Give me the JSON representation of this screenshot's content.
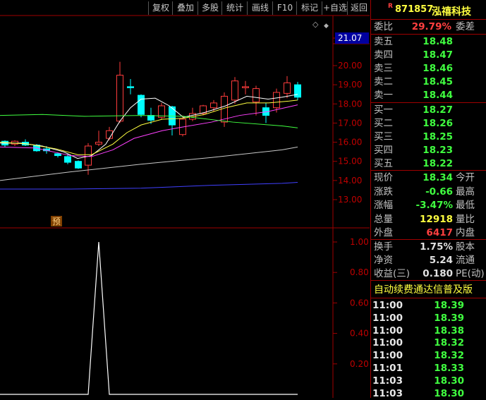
{
  "toolbar": {
    "buttons": [
      "复权",
      "叠加",
      "多股",
      "统计",
      "画线",
      "F10",
      "标记",
      "+自选",
      "返回"
    ]
  },
  "price_axis": [
    "21.07",
    "20.00",
    "19.00",
    "18.00",
    "17.00",
    "16.00",
    "15.00",
    "14.00",
    "13.00"
  ],
  "indicator_axis": [
    "1.00",
    "0.80",
    "0.60",
    "0.40",
    "0.20"
  ],
  "marker_label": "预",
  "stock": {
    "flag": "R",
    "code": "871857",
    "name": "泓禧科技"
  },
  "ratio": {
    "label": "委比",
    "value": "29.79%",
    "label2": "委差"
  },
  "asks": [
    {
      "label": "卖五",
      "price": "18.48"
    },
    {
      "label": "卖四",
      "price": "18.47"
    },
    {
      "label": "卖三",
      "price": "18.46"
    },
    {
      "label": "卖二",
      "price": "18.45"
    },
    {
      "label": "卖一",
      "price": "18.44"
    }
  ],
  "bids": [
    {
      "label": "买一",
      "price": "18.27"
    },
    {
      "label": "买二",
      "price": "18.26"
    },
    {
      "label": "买三",
      "price": "18.25"
    },
    {
      "label": "买四",
      "price": "18.23"
    },
    {
      "label": "买五",
      "price": "18.22"
    }
  ],
  "quote": [
    {
      "label": "现价",
      "value": "18.34",
      "label2": "今开",
      "color": "#40ff40"
    },
    {
      "label": "涨跌",
      "value": "-0.66",
      "label2": "最高",
      "color": "#40ff40"
    },
    {
      "label": "涨幅",
      "value": "-3.47%",
      "label2": "最低",
      "color": "#40ff40"
    },
    {
      "label": "总量",
      "value": "12918",
      "label2": "量比",
      "color": "#ffff40"
    },
    {
      "label": "外盘",
      "value": "6417",
      "label2": "内盘",
      "color": "#ff4040"
    }
  ],
  "fundamentals": [
    {
      "label": "换手",
      "value": "1.75%",
      "label2": "股本"
    },
    {
      "label": "净资",
      "value": "5.24",
      "label2": "流通"
    },
    {
      "label": "收益(三)",
      "value": "0.180",
      "label2": "PE(动)"
    }
  ],
  "banner": "自动续费通达信普及版",
  "ticks": [
    {
      "time": "11:00",
      "price": "18.39"
    },
    {
      "time": "11:00",
      "price": "18.39"
    },
    {
      "time": "11:00",
      "price": "18.38"
    },
    {
      "time": "11:00",
      "price": "18.32"
    },
    {
      "time": "11:00",
      "price": "18.32"
    },
    {
      "time": "11:01",
      "price": "18.33"
    },
    {
      "time": "11:03",
      "price": "18.30"
    },
    {
      "time": "11:03",
      "price": "18.30"
    }
  ],
  "colors": {
    "up": "#ff3c3c",
    "down": "#00ffff",
    "ask_price": "#40ff40",
    "ma5": "#ffffff",
    "ma10": "#ffff40",
    "ma20": "#ff40ff",
    "ma60": "#40ff40",
    "ma120": "#c8c8c8",
    "ma250": "#4040ff"
  }
}
